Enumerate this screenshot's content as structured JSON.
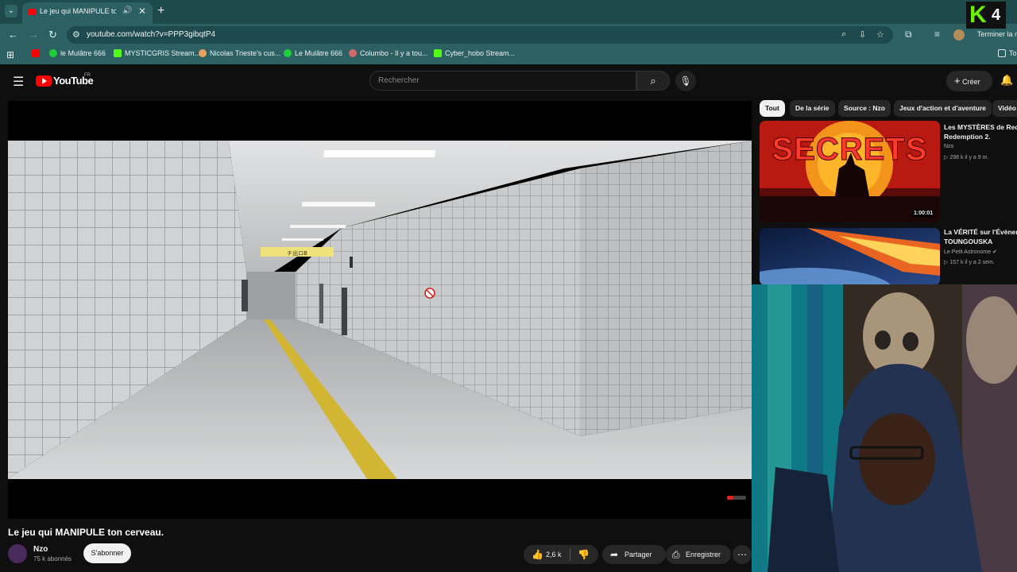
{
  "browser": {
    "tab_title": "Le jeu qui MANIPULE ton c",
    "url": "youtube.com/watch?v=PPP3gibqtP4",
    "finish_label": "Terminer la m",
    "bookmarks": [
      {
        "label": "le Mulâtre 666",
        "color": "#1fcf3a"
      },
      {
        "label": "MYSTICGRIS Stream...",
        "color": "#53fc18"
      },
      {
        "label": "Nicolas Trieste's cus...",
        "color": "#e8a060"
      },
      {
        "label": "Le Mulâtre 666",
        "color": "#1fcf3a"
      },
      {
        "label": "Columbo - Il y a tou...",
        "color": "#d06a6a"
      },
      {
        "label": "Cyber_hobo Stream...",
        "color": "#53fc18"
      }
    ],
    "bookmarks_end": "To"
  },
  "youtube": {
    "logo_text": "YouTube",
    "region": "FR",
    "search_placeholder": "Rechercher",
    "create_label": "Créer"
  },
  "video": {
    "title": "Le jeu qui MANIPULE ton cerveau.",
    "sign_text": "チ出ロB",
    "channel": "Nzo",
    "subscribers": "75 k abonnés",
    "subscribe_label": "S'abonner",
    "likes": "2,6 k",
    "share_label": "Partager",
    "save_label": "Enregistrer"
  },
  "chips": [
    "Tout",
    "De la série",
    "Source : Nzo",
    "Jeux d'action et d'aventure",
    "Vidéo"
  ],
  "recommendations": [
    {
      "thumb_text": "SECRETS",
      "title_1": "Les MYSTÈRES de Red",
      "title_2": "Redemption 2.",
      "channel": "Nzo",
      "meta": "▷ 298 k   il y a 9 m.",
      "duration": "1:00:01"
    },
    {
      "title_1": "La VÉRITÉ sur l'Évènem",
      "title_2": "TOUNGOUSKA",
      "channel": "Le Petit Astronome",
      "meta": "▷ 157 k   il y a 2 sem."
    }
  ],
  "overlay": {
    "logo_k": "K",
    "logo_num": "4"
  }
}
